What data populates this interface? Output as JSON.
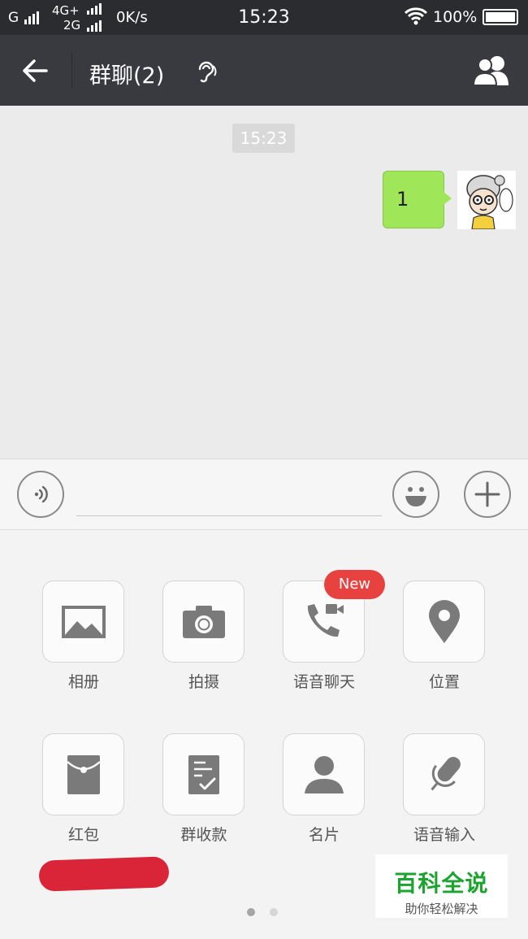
{
  "status_bar": {
    "carrier": "G",
    "network_top": "4G+",
    "network_bottom": "2G",
    "speed": "0K/s",
    "time": "15:23",
    "battery": "100%"
  },
  "header": {
    "title": "群聊(2)",
    "back_icon": "arrow-left-icon",
    "ear_icon": "earpiece-mode-icon",
    "members_icon": "group-members-icon"
  },
  "chat": {
    "timestamp": "15:23",
    "messages": [
      {
        "text": "1",
        "sender": "self",
        "bubble_color": "#9fe758"
      }
    ]
  },
  "input_bar": {
    "voice_icon": "voice-input-icon",
    "emoji_icon": "emoji-icon",
    "plus_icon": "plus-icon",
    "text_value": ""
  },
  "tools": [
    {
      "label": "相册",
      "icon": "photo-album-icon"
    },
    {
      "label": "拍摄",
      "icon": "camera-icon"
    },
    {
      "label": "语音聊天",
      "icon": "voice-call-icon",
      "badge": "New"
    },
    {
      "label": "位置",
      "icon": "location-pin-icon"
    },
    {
      "label": "红包",
      "icon": "red-packet-icon"
    },
    {
      "label": "群收款",
      "icon": "group-collect-icon"
    },
    {
      "label": "名片",
      "icon": "contact-card-icon"
    },
    {
      "label": "语音输入",
      "icon": "microphone-icon"
    }
  ],
  "pager": {
    "pages": 2,
    "current": 1
  },
  "watermark": {
    "title": "百科全说",
    "subtitle": "助你轻松解决"
  },
  "colors": {
    "header_bg": "#393a3f",
    "status_bg": "#2b2c2f",
    "bubble": "#9fe758",
    "badge": "#e84240",
    "annotation": "#d92537",
    "watermark_green": "#1ba42e"
  }
}
